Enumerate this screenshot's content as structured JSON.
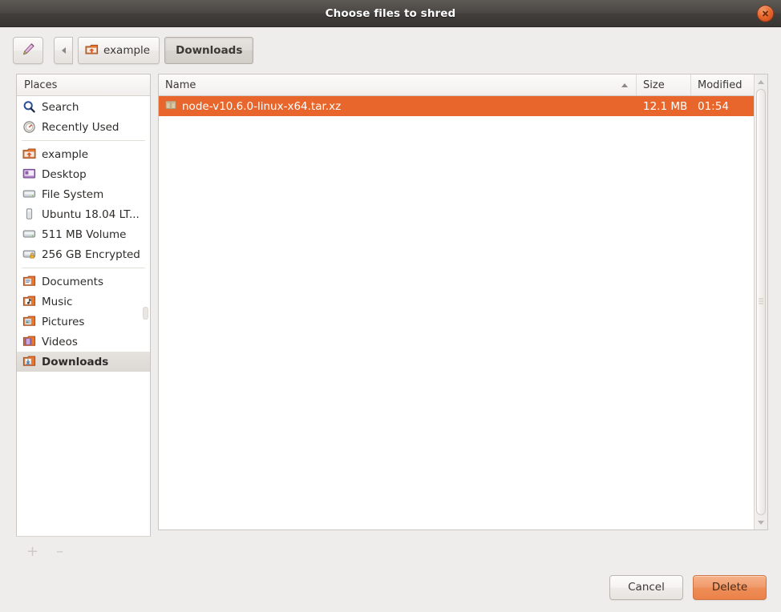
{
  "window": {
    "title": "Choose files to shred",
    "close_icon": "close-icon"
  },
  "toolbar": {
    "edit_icon": "pencil-icon",
    "back_icon": "chevron-left-icon",
    "crumbs": [
      {
        "label": "example",
        "icon": "home-folder-icon",
        "active": false
      },
      {
        "label": "Downloads",
        "icon": "",
        "active": true
      }
    ]
  },
  "sidebar": {
    "header": "Places",
    "groups": [
      {
        "items": [
          {
            "label": "Search",
            "icon": "search-icon",
            "selected": false
          },
          {
            "label": "Recently Used",
            "icon": "recent-clock-icon",
            "selected": false
          }
        ]
      },
      {
        "items": [
          {
            "label": "example",
            "icon": "home-folder-icon",
            "selected": false
          },
          {
            "label": "Desktop",
            "icon": "desktop-icon",
            "selected": false
          },
          {
            "label": "File System",
            "icon": "drive-icon",
            "selected": false
          },
          {
            "label": "Ubuntu 18.04 LT...",
            "icon": "usb-drive-icon",
            "selected": false
          },
          {
            "label": "511 MB Volume",
            "icon": "drive-icon",
            "selected": false
          },
          {
            "label": "256 GB Encrypted",
            "icon": "encrypted-drive-icon",
            "selected": false
          }
        ]
      },
      {
        "items": [
          {
            "label": "Documents",
            "icon": "documents-folder-icon",
            "selected": false
          },
          {
            "label": "Music",
            "icon": "music-folder-icon",
            "selected": false
          },
          {
            "label": "Pictures",
            "icon": "pictures-folder-icon",
            "selected": false
          },
          {
            "label": "Videos",
            "icon": "videos-folder-icon",
            "selected": false
          },
          {
            "label": "Downloads",
            "icon": "downloads-folder-icon",
            "selected": true
          }
        ]
      }
    ],
    "add_label": "+",
    "remove_label": "–"
  },
  "file_list": {
    "columns": [
      {
        "key": "name",
        "label": "Name",
        "sort": "ascending"
      },
      {
        "key": "size",
        "label": "Size",
        "sort": ""
      },
      {
        "key": "modified",
        "label": "Modified",
        "sort": ""
      }
    ],
    "rows": [
      {
        "name": "node-v10.6.0-linux-x64.tar.xz",
        "size": "12.1 MB",
        "modified": "01:54",
        "icon": "archive-file-icon",
        "selected": true
      }
    ]
  },
  "footer": {
    "cancel_label": "Cancel",
    "delete_label": "Delete"
  },
  "colors": {
    "selection": "#e8662b",
    "default_button": "#ee8d58",
    "titlebar": "#44413e",
    "dialog_bg": "#efedeb"
  }
}
